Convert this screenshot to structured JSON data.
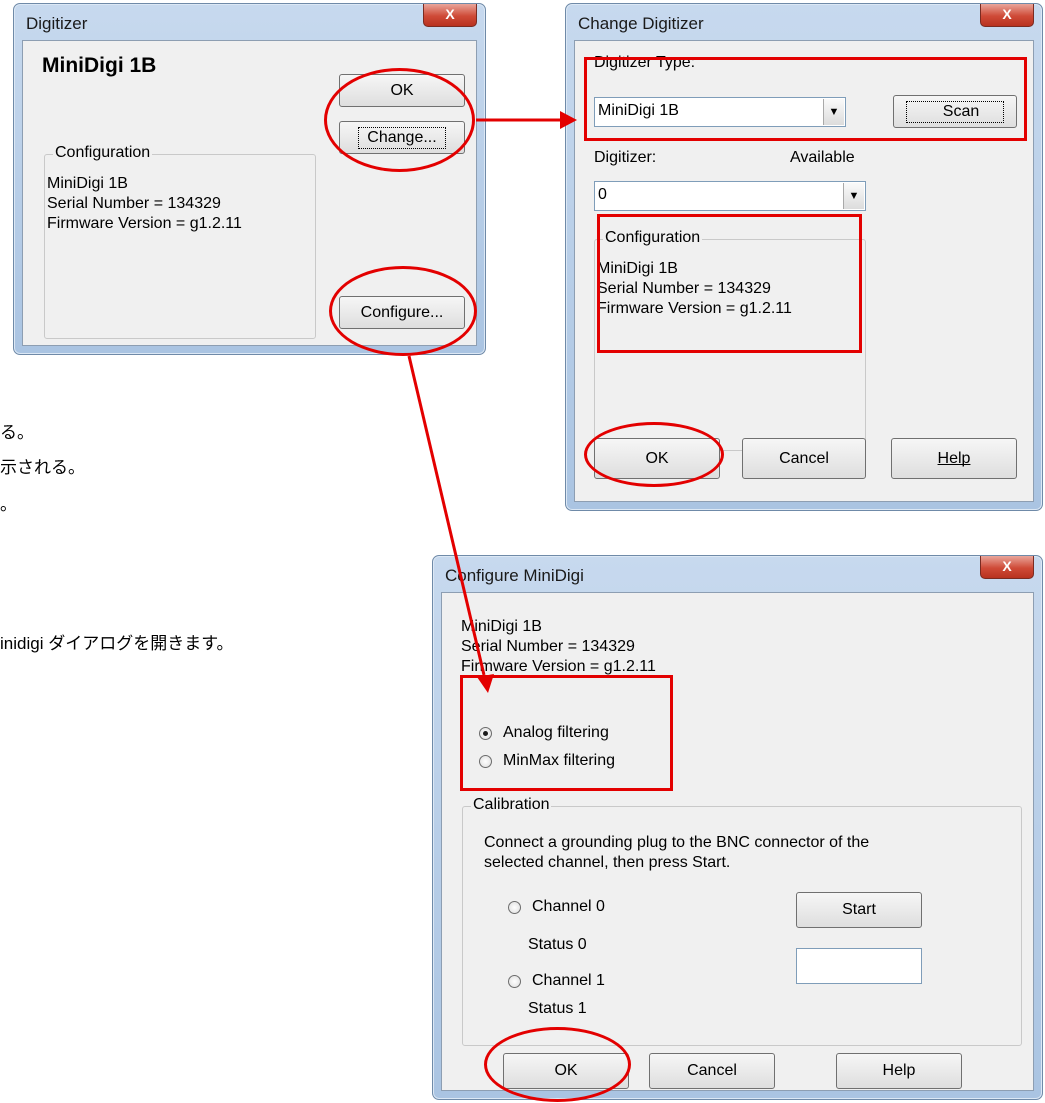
{
  "digitizer_dialog": {
    "title": "Digitizer",
    "close": "X",
    "model_name": "MiniDigi 1B",
    "ok_label": "OK",
    "change_label": "Change...",
    "configure_label": "Configure...",
    "configuration_label": "Configuration",
    "config_lines": [
      "MiniDigi 1B",
      "Serial Number = 134329",
      "Firmware Version = g1.2.11"
    ]
  },
  "change_dialog": {
    "title": "Change Digitizer",
    "close": "X",
    "type_label": "Digitizer Type:",
    "type_value": "MiniDigi 1B",
    "scan_label": "Scan",
    "digitizer_label": "Digitizer:",
    "available_label": "Available",
    "digitizer_value": "0",
    "configuration_label": "Configuration",
    "config_lines": [
      "MiniDigi 1B",
      "Serial Number = 134329",
      "Firmware Version = g1.2.11"
    ],
    "ok_label": "OK",
    "cancel_label": "Cancel",
    "help_label": "Help"
  },
  "configure_dialog": {
    "title": "Configure MiniDigi",
    "close": "X",
    "info_lines": [
      "MiniDigi 1B",
      "Serial Number = 134329",
      "Firmware Version = g1.2.11"
    ],
    "analog_label": "Analog filtering",
    "minmax_label": "MinMax filtering",
    "selected_filter": "analog",
    "calibration_label": "Calibration",
    "instructions": [
      "Connect a grounding plug to the BNC connector of the",
      "selected channel, then press Start."
    ],
    "channel0_label": "Channel 0",
    "status0_label": "Status 0",
    "channel1_label": "Channel 1",
    "status1_label": "Status 1",
    "start_label": "Start",
    "ok_label": "OK",
    "cancel_label": "Cancel",
    "help_label": "Help"
  },
  "annotation_text": {
    "line1": "る。",
    "line2": "示される。",
    "line3": "。",
    "line4": "inidigi ダイアログを開きます。"
  },
  "colors": {
    "highlight": "#e30000",
    "close_button": "#cf4a37"
  }
}
